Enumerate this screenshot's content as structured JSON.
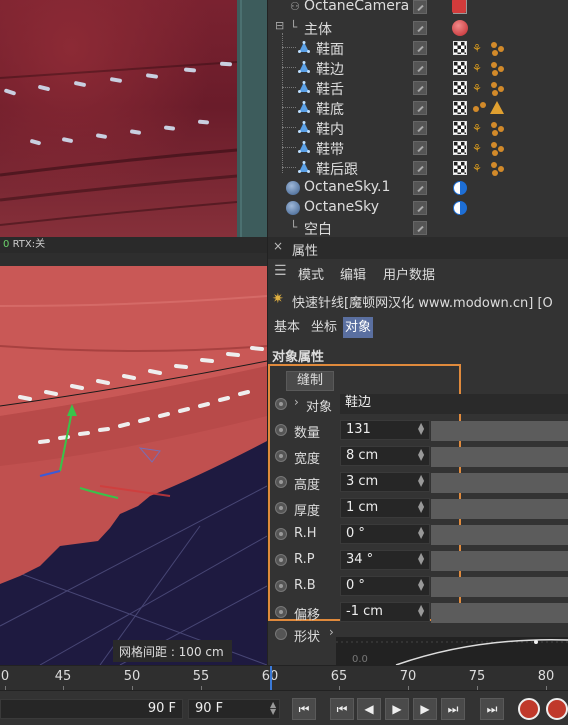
{
  "render_status": {
    "prefix": "0",
    "label": "RTX:",
    "value": "关"
  },
  "object_manager": {
    "camera": {
      "name": "OctaneCamera"
    },
    "group": {
      "name": "主体"
    },
    "children": [
      {
        "name": "鞋面"
      },
      {
        "name": "鞋边"
      },
      {
        "name": "鞋舌"
      },
      {
        "name": "鞋底"
      },
      {
        "name": "鞋内"
      },
      {
        "name": "鞋带"
      },
      {
        "name": "鞋后跟"
      }
    ],
    "sky1": {
      "name": "OctaneSky.1"
    },
    "sky": {
      "name": "OctaneSky"
    },
    "null": {
      "name": "空白"
    }
  },
  "attributes": {
    "panel_title": "属性",
    "menu": {
      "mode": "模式",
      "edit": "编辑",
      "user_data": "用户数据"
    },
    "object_title": "快速针线[魔顿网汉化 www.modown.cn] [O",
    "tabs": {
      "basic": "基本",
      "coord": "坐标",
      "object": "对象"
    },
    "section": "对象属性",
    "stitch_button": "缝制",
    "object_link": {
      "label": "对象",
      "value": "鞋边"
    },
    "params": [
      {
        "label": "数量",
        "value": "131"
      },
      {
        "label": "宽度",
        "value": "8 cm"
      },
      {
        "label": "高度",
        "value": "3 cm"
      },
      {
        "label": "厚度",
        "value": "1 cm"
      },
      {
        "label": "R.H",
        "value": "0 °"
      },
      {
        "label": "R.P",
        "value": "34 °"
      },
      {
        "label": "R.B",
        "value": "0 °"
      },
      {
        "label": "偏移",
        "value": "-1 cm"
      }
    ],
    "shape_label": "形状",
    "shape_graph_tick": "0.0"
  },
  "viewport": {
    "grid_label": "网格间距 : 100 cm"
  },
  "timeline": {
    "ticks": [
      "0",
      "45",
      "50",
      "55",
      "60",
      "65",
      "70",
      "75",
      "80"
    ],
    "current_frame": "90 F",
    "end_frame": "90 F"
  },
  "colors": {
    "highlight_box": "#e08a3c",
    "active_tab": "#5a6fa0",
    "playhead": "#3b7ad8",
    "record": "#c0392b"
  }
}
